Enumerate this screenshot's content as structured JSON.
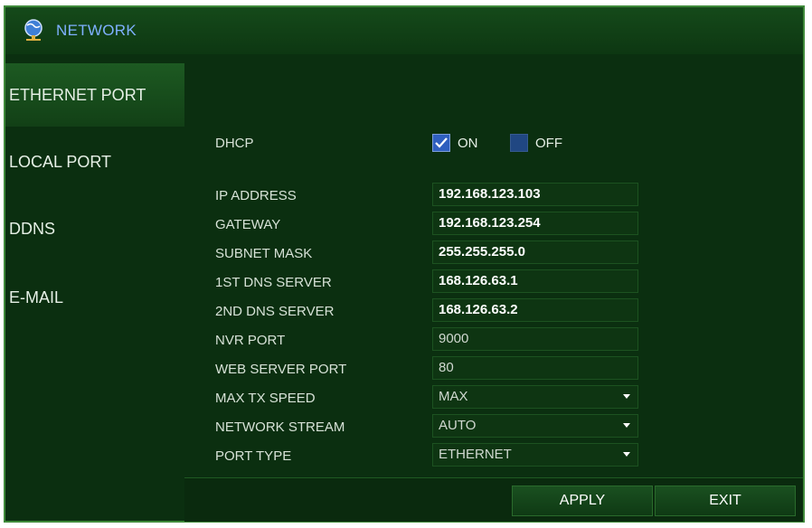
{
  "window": {
    "title": "NETWORK",
    "title_icon": "globe-network-icon"
  },
  "sidebar": {
    "items": [
      {
        "label": "ETHERNET PORT",
        "active": true
      },
      {
        "label": "LOCAL PORT",
        "active": false
      },
      {
        "label": "DDNS",
        "active": false
      },
      {
        "label": "E-MAIL",
        "active": false
      }
    ]
  },
  "form": {
    "dhcp": {
      "label": "DHCP",
      "on_label": "ON",
      "off_label": "OFF",
      "on_checked": true,
      "off_checked": false
    },
    "ip_address": {
      "label": "IP ADDRESS",
      "value": "192.168.123.103"
    },
    "gateway": {
      "label": "GATEWAY",
      "value": "192.168.123.254"
    },
    "subnet_mask": {
      "label": "SUBNET MASK",
      "value": "255.255.255.0"
    },
    "dns1": {
      "label": "1ST DNS SERVER",
      "value": "168.126.63.1"
    },
    "dns2": {
      "label": "2ND DNS SERVER",
      "value": "168.126.63.2"
    },
    "nvr_port": {
      "label": "NVR PORT",
      "value": "9000"
    },
    "web_port": {
      "label": "WEB SERVER PORT",
      "value": "80"
    },
    "max_tx_speed": {
      "label": "MAX TX SPEED",
      "value": "MAX"
    },
    "network_stream": {
      "label": "NETWORK STREAM",
      "value": "AUTO"
    },
    "port_type": {
      "label": "PORT TYPE",
      "value": "ETHERNET"
    }
  },
  "footer": {
    "apply_label": "APPLY",
    "exit_label": "EXIT"
  },
  "colors": {
    "background": "#0b2f10",
    "accent_title": "#7fb0ff",
    "checkbox": "#2f5fbf"
  }
}
